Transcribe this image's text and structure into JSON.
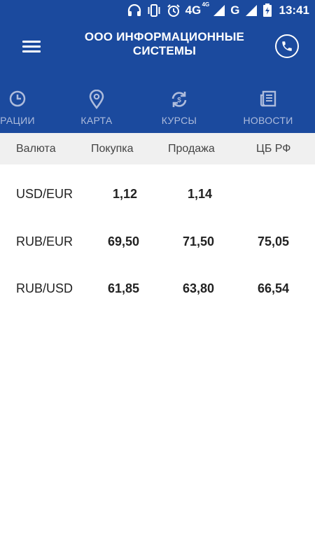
{
  "status_bar": {
    "network_label": "4G",
    "network_sup": "4G",
    "g_label": "G",
    "time": "13:41"
  },
  "app_bar": {
    "title": "ООО ИНФОРМАЦИОННЫЕ\nСИСТЕМЫ"
  },
  "tabs": [
    {
      "label": "РАЦИИ",
      "icon": "clock-icon",
      "active": false
    },
    {
      "label": "КАРТА",
      "icon": "map-pin-icon",
      "active": false
    },
    {
      "label": "КУРСЫ",
      "icon": "currency-exchange-icon",
      "active": true
    },
    {
      "label": "НОВОСТИ",
      "icon": "newspaper-icon",
      "active": false
    }
  ],
  "table": {
    "headers": [
      "Валюта",
      "Покупка",
      "Продажа",
      "ЦБ РФ"
    ],
    "rows": [
      {
        "pair": "USD/EUR",
        "buy": "1,12",
        "sell": "1,14",
        "cbr": ""
      },
      {
        "pair": "RUB/EUR",
        "buy": "69,50",
        "sell": "71,50",
        "cbr": "75,05"
      },
      {
        "pair": "RUB/USD",
        "buy": "61,85",
        "sell": "63,80",
        "cbr": "66,54"
      }
    ]
  },
  "colors": {
    "primary": "#1b4a9e",
    "header_bg": "#f0f0f0",
    "tab_inactive": "#aebcdc"
  }
}
